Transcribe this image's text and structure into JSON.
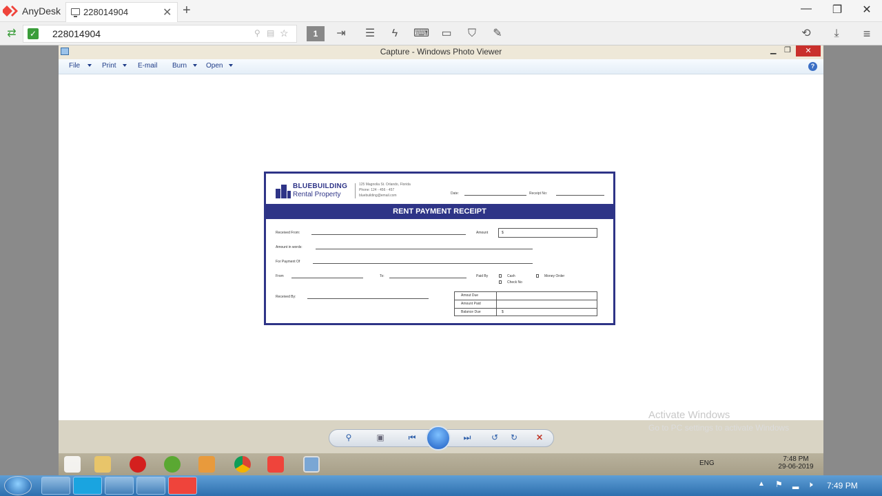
{
  "anydesk": {
    "app_name": "AnyDesk",
    "tab_label": "228014904",
    "address": "228014904",
    "monitor_number": "1"
  },
  "photo_viewer": {
    "title": "Capture - Windows Photo Viewer",
    "menu": [
      {
        "label": "File",
        "access": "F"
      },
      {
        "label": "Print"
      },
      {
        "label": "E-mail"
      },
      {
        "label": "Burn"
      },
      {
        "label": "Open"
      }
    ],
    "help_label": "?",
    "activation_title": "Activate Windows",
    "activation_sub": "Go to PC settings to activate Windows"
  },
  "receipt": {
    "brand_line1": "BLUEBUILDING",
    "brand_line2": "Rental Property",
    "address_line1": "125 Magnolia St. Orlando, Florida",
    "address_line2": "Phone: 124 - 456 - 457",
    "address_line3": "bluebuilding@email.com",
    "date_label": "Date:",
    "receipt_no_label": "Receipt No:",
    "title": "RENT PAYMENT RECEIPT",
    "received_from_label": "Received From:",
    "amount_label": "Amount",
    "amount_prefix": "$",
    "amount_in_words_label": "Amount in words:",
    "for_payment_of_label": "For Payment Of",
    "from_label": "From",
    "to_label": "To:",
    "paid_by_label": "Paid By",
    "cash_label": "Cash",
    "money_order_label": "Money Order",
    "check_no_label": "Check No",
    "received_by_label": "Received By:",
    "amount_due_label": "Amout Due",
    "amount_paid_label": "Amount Paid",
    "balance_due_label": "Balance Due",
    "balance_prefix": "$"
  },
  "remote_taskbar": {
    "language": "ENG",
    "time": "7:48 PM",
    "date": "29-06-2019"
  },
  "taskbar": {
    "clock": "7:49 PM"
  }
}
